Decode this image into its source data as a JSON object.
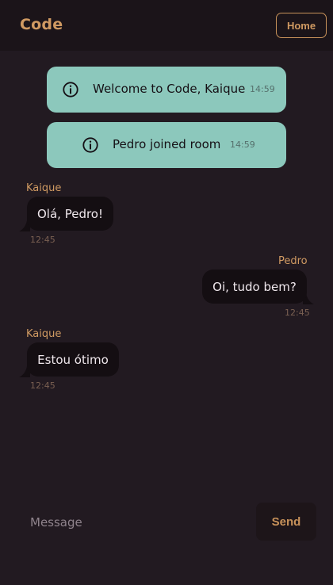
{
  "header": {
    "brand": "Code",
    "home_label": "Home"
  },
  "system_messages": [
    {
      "icon": "info-icon",
      "text": "Welcome to Code, Kaique",
      "time": "14:59"
    },
    {
      "icon": "info-icon",
      "text": "Pedro joined room",
      "time": "14:59"
    }
  ],
  "messages": [
    {
      "sender": "Kaique",
      "text": "Olá, Pedro!",
      "time": "12:45",
      "side": "left"
    },
    {
      "sender": "Pedro",
      "text": "Oi, tudo bem?",
      "time": "12:45",
      "side": "right"
    },
    {
      "sender": "Kaique",
      "text": "Estou ótimo",
      "time": "12:45",
      "side": "left"
    }
  ],
  "composer": {
    "placeholder": "Message",
    "value": "",
    "send_label": "Send"
  },
  "colors": {
    "background": "#221a21",
    "header": "#1b1419",
    "accent": "#d09a62",
    "system_bubble": "#8cc8bc",
    "message_bubble": "#140e12"
  }
}
